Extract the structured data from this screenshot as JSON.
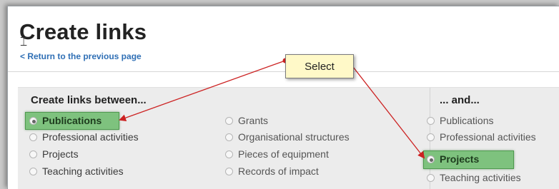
{
  "page": {
    "title": "Create links",
    "back_link": "< Return to the previous page"
  },
  "links": {
    "left_heading": "Create links between...",
    "right_heading": "... and...",
    "left_col1": [
      "Publications",
      "Professional activities",
      "Projects",
      "Teaching activities"
    ],
    "left_col2": [
      "Grants",
      "Organisational structures",
      "Pieces of equipment",
      "Records of impact"
    ],
    "right_col": [
      "Publications",
      "Professional activities",
      "Projects",
      "Teaching activities"
    ],
    "selected_left": "Publications",
    "selected_right": "Projects"
  },
  "annotation": {
    "label": "Select",
    "highlight_color": "#7ec27e",
    "arrow_color": "#cc2222",
    "box_color": "#fff9c8"
  }
}
